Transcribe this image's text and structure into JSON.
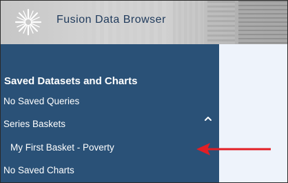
{
  "header": {
    "title": "Fusion Data Browser",
    "logo_icon": "starburst-logo-icon"
  },
  "sidebar": {
    "section_title": "Saved Datasets and Charts",
    "items": [
      {
        "label": "No Saved Queries"
      },
      {
        "label": "Series Baskets",
        "expanded": true,
        "toggle_icon": "chevron-up-icon"
      },
      {
        "label": "My First Basket - Poverty"
      },
      {
        "label": "No Saved Charts"
      }
    ]
  },
  "annotation": {
    "icon": "red-arrow-left-icon",
    "color": "#e31e24"
  },
  "colors": {
    "sidebar_bg": "#2a5177",
    "content_bg": "#eef3fb",
    "title_text": "#1f3a5c"
  }
}
